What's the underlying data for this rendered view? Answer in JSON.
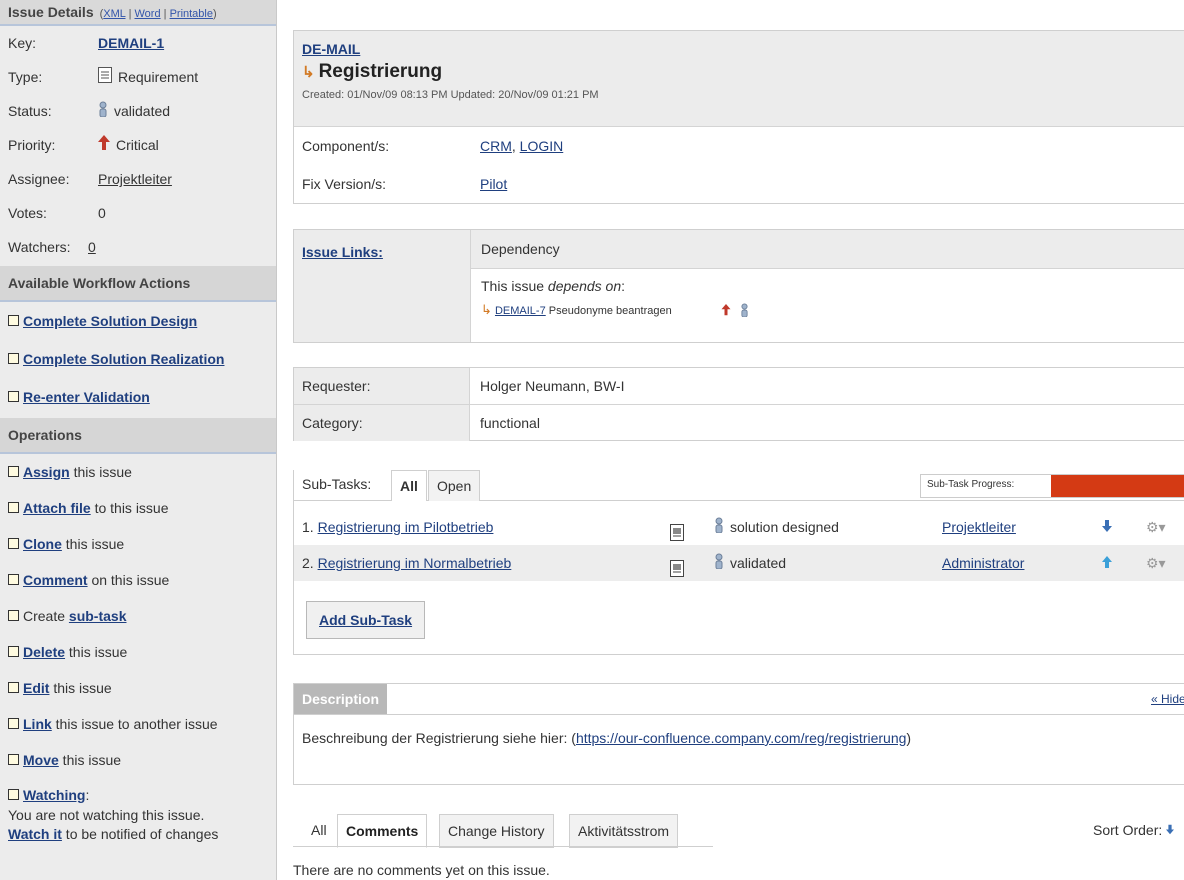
{
  "sidebar": {
    "header": {
      "title": "Issue Details",
      "xml": "XML",
      "sep1": "|",
      "word": "Word",
      "sep2": "|",
      "printable": "Printable",
      "open_paren": "(",
      "close_paren": ")"
    },
    "details": {
      "key_label": "Key:",
      "key_value": "DEMAIL-1",
      "type_label": "Type:",
      "type_value": "Requirement",
      "status_label": "Status:",
      "status_value": "validated",
      "priority_label": "Priority:",
      "priority_value": "Critical",
      "assignee_label": "Assignee:",
      "assignee_value": "Projektleiter",
      "votes_label": "Votes:",
      "votes_value": "0",
      "watchers_label": "Watchers:",
      "watchers_value": "0"
    },
    "workflow_title": "Available Workflow Actions",
    "workflow": [
      "Complete Solution Design",
      "Complete Solution Realization",
      "Re-enter Validation"
    ],
    "operations_title": "Operations",
    "operations": [
      {
        "link": "Assign",
        "rest": " this issue"
      },
      {
        "link": "Attach file",
        "rest": " to this issue"
      },
      {
        "link": "Clone",
        "rest": " this issue"
      },
      {
        "link": "Comment",
        "rest": " on this issue"
      },
      {
        "pre": "Create ",
        "link": "sub-task",
        "rest": ""
      },
      {
        "link": "Delete",
        "rest": " this issue"
      },
      {
        "link": "Edit",
        "rest": " this issue"
      },
      {
        "link": "Link",
        "rest": " this issue to another issue"
      },
      {
        "link": "Move",
        "rest": " this issue"
      },
      {
        "link": "Watching",
        "rest": ":"
      }
    ],
    "watch_note": "You are not watching this issue.",
    "watch_link": "Watch it",
    "watch_rest": " to be notified of changes"
  },
  "issue": {
    "project": "DE-MAIL",
    "title": "Registrierung",
    "dates": "Created: 01/Nov/09 08:13 PM   Updated: 20/Nov/09 01:21 PM",
    "components_label": "Component/s:",
    "component1": "CRM",
    "component2": "LOGIN",
    "fixver_label": "Fix Version/s:",
    "fixver": "Pilot"
  },
  "links": {
    "label": "Issue Links:",
    "type": "Dependency",
    "desc_pre": "This issue ",
    "desc_em": "depends on",
    "desc_post": ":",
    "item_key": "DEMAIL-7",
    "item_title": "Pseudonyme beantragen"
  },
  "meta": {
    "requester_label": "Requester:",
    "requester": "Holger Neumann, BW-I",
    "category_label": "Category:",
    "category": "functional"
  },
  "subtasks": {
    "label": "Sub-Tasks:",
    "tab_all": "All",
    "tab_open": "Open",
    "progress_label": "Sub-Task Progress:",
    "progress": 1.0,
    "rows": [
      {
        "num": "1.",
        "title": "Registrierung im Pilotbetrieb",
        "status": "solution designed",
        "assignee": "Projektleiter"
      },
      {
        "num": "2.",
        "title": "Registrierung im Normalbetrieb",
        "status": "validated",
        "assignee": "Administrator"
      }
    ],
    "add_button": "Add Sub-Task"
  },
  "description": {
    "title": "Description",
    "hide": "« Hide",
    "text_pre": "Beschreibung der Registrierung siehe hier: (",
    "url": "https://our-confluence.company.com/reg/registrierung",
    "text_post": ")"
  },
  "activity": {
    "tabs": [
      "All",
      "Comments",
      "Change History",
      "Aktivitätsstrom"
    ],
    "sort_label": "Sort Order:",
    "empty": "There are no comments yet on this issue."
  },
  "colors": {
    "link": "#1f3f7f",
    "progress": "#d43a14",
    "priority": "#c0392b",
    "sidebar_bg": "#ececec"
  }
}
